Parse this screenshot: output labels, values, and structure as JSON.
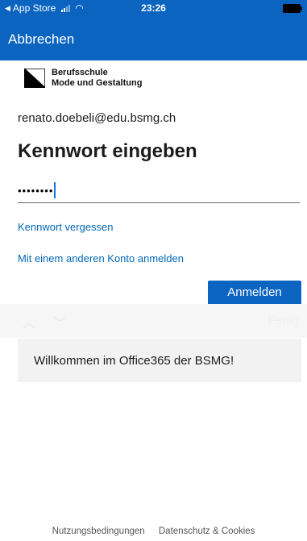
{
  "status_bar": {
    "back_label": "App Store",
    "time": "23:26"
  },
  "top_bar": {
    "cancel_label": "Abbrechen"
  },
  "logo": {
    "line1": "Berufsschule",
    "line2": "Mode und Gestaltung"
  },
  "account": {
    "email": "renato.doebeli@edu.bsmg.ch"
  },
  "form": {
    "heading": "Kennwort eingeben",
    "password_masked": "••••••••",
    "forgot_password": "Kennwort vergessen",
    "other_account": "Mit einem anderen Konto anmelden",
    "signin_label": "Anmelden"
  },
  "keyboard_accessory": {
    "done_label": "Fertig"
  },
  "welcome": {
    "text": "Willkommen im Office365 der BSMG!"
  },
  "footer": {
    "terms": "Nutzungsbedingungen",
    "privacy": "Datenschutz & Cookies"
  },
  "colors": {
    "accent": "#0a64c0",
    "link": "#0067b8"
  }
}
